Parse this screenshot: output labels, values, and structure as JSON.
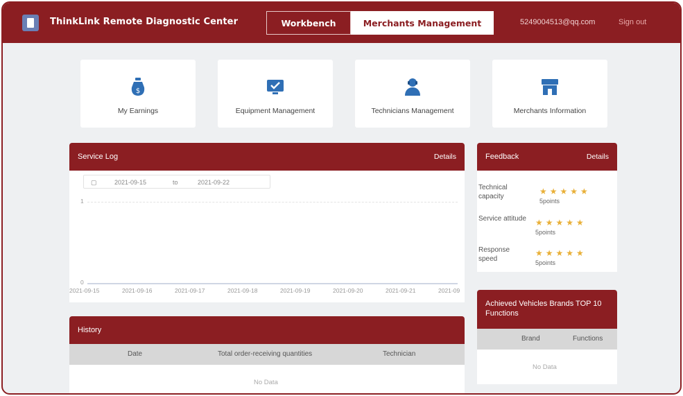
{
  "header": {
    "app_title": "ThinkLink Remote Diagnostic Center",
    "tabs": [
      "Workbench",
      "Merchants Management"
    ],
    "active_tab": "Merchants Management",
    "user_email": "5249004513@qq.com",
    "sign_out": "Sign out",
    "brand_color": "#8b1e22"
  },
  "quick_cards": [
    {
      "label": "My Earnings",
      "icon": "money-bag-icon"
    },
    {
      "label": "Equipment Management",
      "icon": "monitor-check-icon"
    },
    {
      "label": "Technicians Management",
      "icon": "technician-icon"
    },
    {
      "label": "Merchants Information",
      "icon": "store-icon"
    }
  ],
  "service_log": {
    "title": "Service Log",
    "details": "Details",
    "date_from": "2021-09-15",
    "date_sep": "to",
    "date_to": "2021-09-22",
    "y_ticks": [
      "1",
      "0"
    ],
    "x_ticks": [
      "2021-09-15",
      "2021-09-16",
      "2021-09-17",
      "2021-09-18",
      "2021-09-19",
      "2021-09-20",
      "2021-09-21",
      "2021-09"
    ]
  },
  "feedback": {
    "title": "Feedback",
    "details": "Details",
    "rows": [
      {
        "label": "Technical capacity",
        "stars": "★★★★★",
        "sub": "5points"
      },
      {
        "label": "Service attitude",
        "stars": "★★★★★",
        "sub": "5points"
      },
      {
        "label": "Response speed",
        "stars": "★★★★★",
        "sub": "5points"
      }
    ]
  },
  "ranking": {
    "title": "Achieved Vehicles Brands TOP 10 Functions",
    "col_brand": "Brand",
    "col_functions": "Functions",
    "empty": "No Data"
  },
  "history": {
    "title": "History",
    "col_date": "Date",
    "col_total": "Total order-receiving quantities",
    "col_technician": "Technician",
    "empty": "No Data"
  }
}
